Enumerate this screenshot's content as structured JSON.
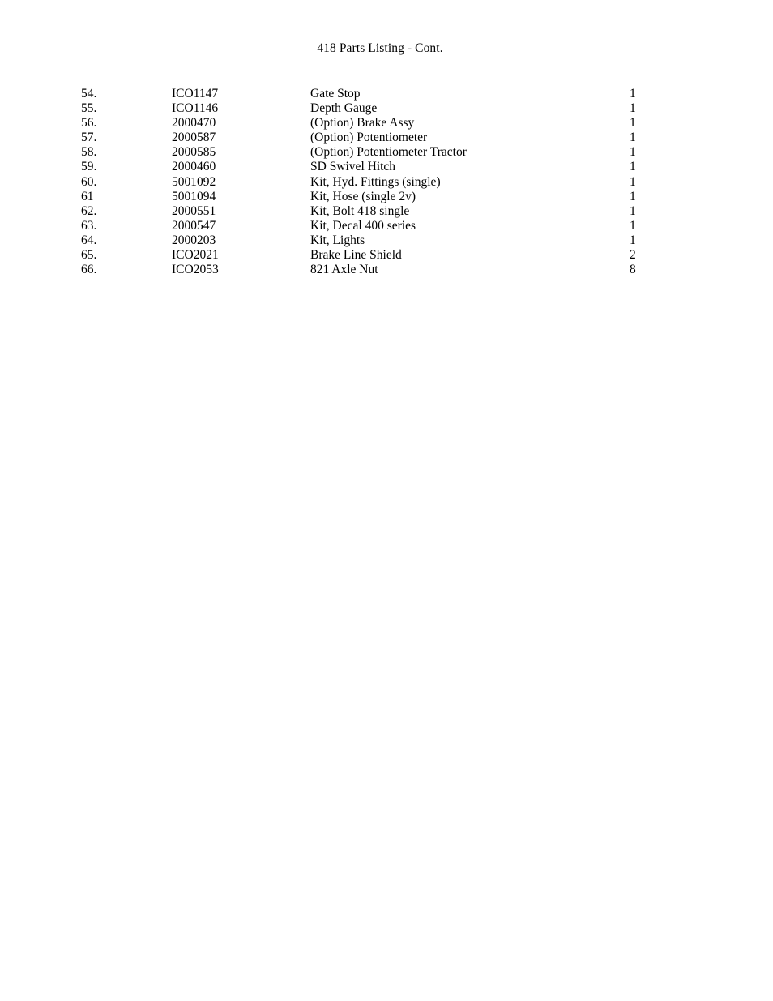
{
  "document": {
    "title": "418 Parts Listing - Cont."
  },
  "table": {
    "rows": [
      {
        "item": "54.",
        "part": "ICO1147",
        "description": "Gate Stop",
        "qty": "1"
      },
      {
        "item": "55.",
        "part": "ICO1146",
        "description": "Depth Gauge",
        "qty": "1"
      },
      {
        "item": "56.",
        "part": "2000470",
        "description": "(Option) Brake Assy",
        "qty": "1"
      },
      {
        "item": "57.",
        "part": "2000587",
        "description": "(Option) Potentiometer",
        "qty": "1"
      },
      {
        "item": "58.",
        "part": "2000585",
        "description": "(Option) Potentiometer Tractor",
        "qty": "1"
      },
      {
        "item": "59.",
        "part": "2000460",
        "description": "SD Swivel Hitch",
        "qty": "1"
      },
      {
        "item": "60.",
        "part": "5001092",
        "description": "Kit, Hyd. Fittings (single)",
        "qty": "1"
      },
      {
        "item": "61",
        "part": "5001094",
        "description": "Kit, Hose (single 2v)",
        "qty": "1"
      },
      {
        "item": "62.",
        "part": "2000551",
        "description": "Kit, Bolt 418 single",
        "qty": "1"
      },
      {
        "item": "63.",
        "part": "2000547",
        "description": "Kit, Decal 400 series",
        "qty": "1"
      },
      {
        "item": "64.",
        "part": "2000203",
        "description": "Kit, Lights",
        "qty": "1"
      },
      {
        "item": "65.",
        "part": "ICO2021",
        "description": "Brake Line Shield",
        "qty": "2"
      },
      {
        "item": "66.",
        "part": "ICO2053",
        "description": "821 Axle Nut",
        "qty": "8"
      }
    ]
  }
}
